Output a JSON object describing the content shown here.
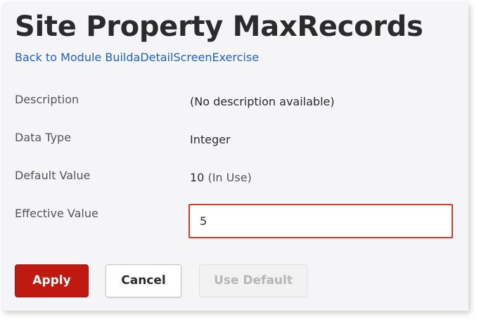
{
  "page": {
    "title": "Site Property MaxRecords",
    "back_link": "Back to Module BuildaDetailScreenExercise"
  },
  "fields": {
    "description": {
      "label": "Description",
      "value": "(No description available)"
    },
    "data_type": {
      "label": "Data Type",
      "value": "Integer"
    },
    "default_value": {
      "label": "Default Value",
      "value": "10",
      "note": "(In Use)"
    },
    "effective_value": {
      "label": "Effective Value",
      "value": "5"
    }
  },
  "actions": {
    "apply_label": "Apply",
    "cancel_label": "Cancel",
    "use_default_label": "Use Default",
    "use_default_enabled": false
  },
  "colors": {
    "primary_button": "#c01a10",
    "link": "#1f62c9",
    "input_error_border": "#d53a26",
    "panel_background": "#f5f5f7"
  }
}
